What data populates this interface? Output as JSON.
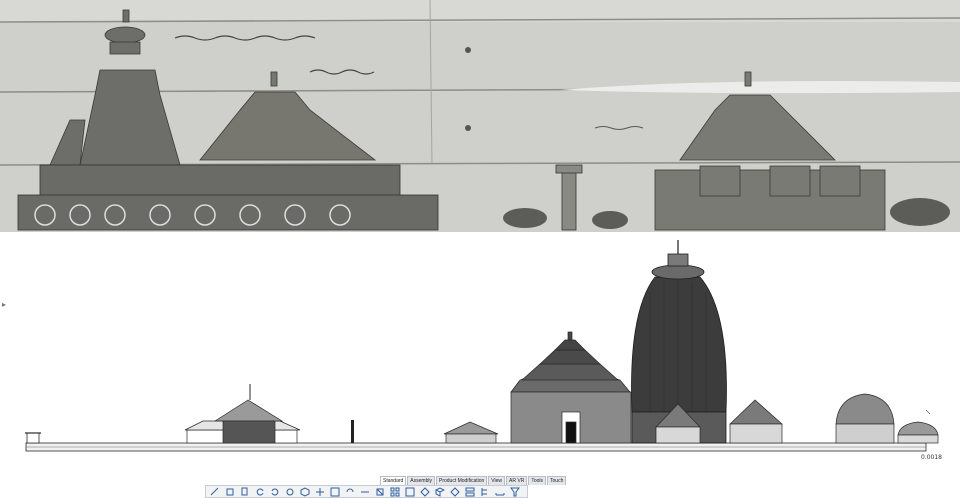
{
  "scale_readout": "0.0018",
  "ribbon": {
    "tabs": [
      {
        "label": "Standard",
        "active": true
      },
      {
        "label": "Assembly",
        "active": false
      },
      {
        "label": "Product Modification",
        "active": false
      },
      {
        "label": "View",
        "active": false
      },
      {
        "label": "AR VR",
        "active": false
      },
      {
        "label": "Tools",
        "active": false
      },
      {
        "label": "Touch",
        "active": false
      }
    ]
  },
  "toolbar_icons": [
    "cut-icon",
    "copy-icon",
    "paste-icon",
    "undo-icon",
    "redo-icon",
    "zoom-icon",
    "box-icon",
    "pan-icon",
    "fit-icon",
    "rotate-icon",
    "look-icon",
    "normal-view-icon",
    "multi-view-icon",
    "shade-icon",
    "hide-icon",
    "iso-view-icon",
    "render-icon",
    "layout-icon",
    "tree-icon",
    "measure-icon",
    "filter-icon"
  ],
  "colors": {
    "manuscript_bg": "#c9c9c6",
    "cad_bg": "#ffffff",
    "line": "#2a2a2a",
    "dark_shade": "#3c3c3c"
  }
}
